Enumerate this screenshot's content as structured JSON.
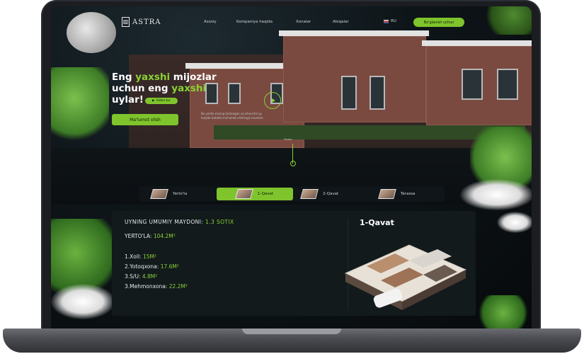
{
  "brand": {
    "name": "ASTRA"
  },
  "nav": {
    "items": [
      "Asosiy",
      "Kompaniya haqida",
      "Xonalar",
      "Aloqalar"
    ],
    "language": "RU",
    "cta_label": "Bo'glanish uchun"
  },
  "hero": {
    "title_part1": "Eng ",
    "title_hl1": "yaxshi",
    "title_part2": " mijozlar uchun eng ",
    "title_hl2": "yaxshi",
    "title_part3": " uylar!",
    "badge": "Video tur",
    "button_label": "Ma'lumot olish",
    "description": "Bu yerda sizning tanlangan va ishonchli uy haqida batafsil ma'lumot olishingiz mumkin.",
    "scroll_label": "Pastga"
  },
  "tabs": [
    {
      "label": "Yerto'la",
      "active": false
    },
    {
      "label": "1-Qavat",
      "active": true
    },
    {
      "label": "2-Qavat",
      "active": false
    },
    {
      "label": "Terassa",
      "active": false
    }
  ],
  "info": {
    "area_label": "UYNING UMUMIY MAYDONI:",
    "area_value": "1.3 SOTIX",
    "basement_label": "YERTO'LA:",
    "basement_value": "104.2M²",
    "rooms": [
      {
        "label": "1.Xoll:",
        "value": "15M²"
      },
      {
        "label": "2.Yotoqxona:",
        "value": "17.6M²"
      },
      {
        "label": "3.S/U:",
        "value": "4.8M²"
      },
      {
        "label": "3.Mehmonxona:",
        "value": "22.2M²"
      }
    ],
    "floor_title": "1-Qavat"
  },
  "colors": {
    "accent": "#7fc42c",
    "background": "#0b0f12",
    "card": "#121a1c"
  }
}
